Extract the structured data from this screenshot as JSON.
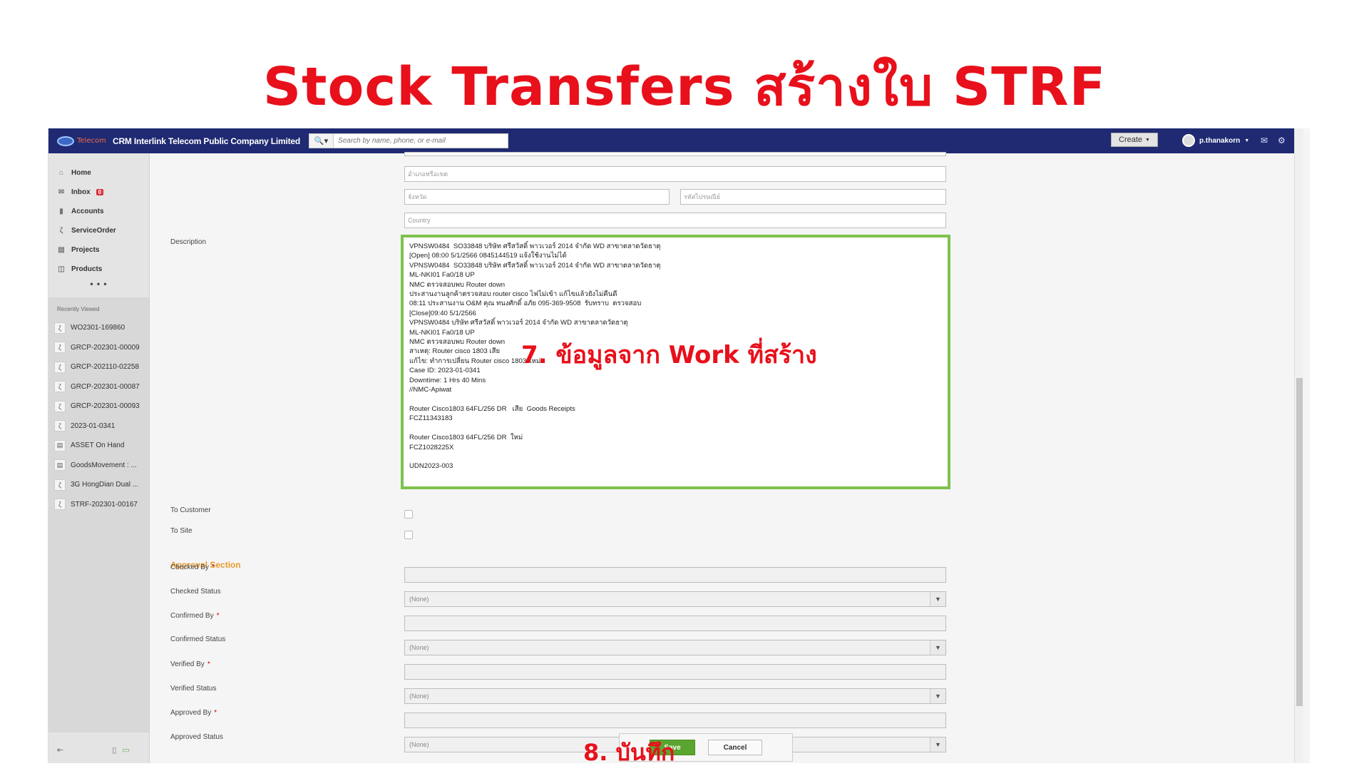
{
  "slide_title": "Stock Transfers สร้างใบ STRF",
  "header": {
    "logo_text": "Telecom",
    "company": "CRM Interlink Telecom Public Company Limited",
    "search_placeholder": "Search by name, phone, or e-mail",
    "create_label": "Create",
    "username": "p.thanakorn"
  },
  "sidebar": {
    "items": [
      {
        "label": "Home"
      },
      {
        "label": "Inbox",
        "badge": "0"
      },
      {
        "label": "Accounts"
      },
      {
        "label": "ServiceOrder"
      },
      {
        "label": "Projects"
      },
      {
        "label": "Products"
      }
    ],
    "more": "• • •",
    "recent_title": "Recently Viewed",
    "recent": [
      "WO2301-169860",
      "GRCP-202301-00009",
      "GRCP-202110-02258",
      "GRCP-202301-00087",
      "GRCP-202301-00093",
      "2023-01-0341",
      "ASSET On Hand",
      "GoodsMovement : ...",
      "3G HongDian Dual ...",
      "STRF-202301-00167"
    ]
  },
  "form": {
    "district_placeholder": "อำเภอหรือเขต",
    "province_placeholder": "จังหวัด",
    "postcode_placeholder": "รหัสไปรษณีย์",
    "country_placeholder": "Country",
    "description_label": "Description",
    "description_value": "VPNSW0484  SO33848 บริษัท ศรีสวัสดิ์ พาวเวอร์ 2014 จำกัด WD สาขาตลาดวัดธาตุ\n[Open] 08:00 5/1/2566 0845144519 แจ้งใช้งานไม่ได้\nVPNSW0484  SO33848 บริษัท ศรีสวัสดิ์ พาวเวอร์ 2014 จำกัด WD สาขาตลาดวัดธาตุ\nML-NKI01 Fa0/18 UP\nNMC ตรวจสอบพบ Router down\nประสานงานลูกค้าตรวจสอบ router cisco ไฟไม่เข้า แก้ไขแล้วยังไม่คืนดี\n08:11 ประสานงาน O&M คุณ ทนงศักดิ์ อภัย 095-369-9508  รับทราบ  ตรวจสอบ\n[Close]09:40 5/1/2566\nVPNSW0484 บริษัท ศรีสวัสดิ์ พาวเวอร์ 2014 จำกัด WD สาขาตลาดวัดธาตุ\nML-NKI01 Fa0/18 UP\nNMC ตรวจสอบพบ Router down\nสาเหตุ: Router cisco 1803 เสีย\nแก้ไข: ทำการเปลี่ยน Router cisco 1803 ใหม่\nCase ID: 2023-01-0341\nDowntime: 1 Hrs 40 Mins\n//NMC-Apiwat\n\nRouter Cisco1803 64FL/256 DR   เสีย  Goods Receipts\nFCZ11343183\n\nRouter Cisco1803 64FL/256 DR  ใหม่\nFCZ1028225X\n\nUDN2023-003",
    "to_customer_label": "To Customer",
    "to_site_label": "To Site",
    "approval_section": "Approval Section",
    "approval_rows": [
      {
        "label": "Checked By",
        "required": "*"
      },
      {
        "label": "Checked Status",
        "value": "(None)"
      },
      {
        "label": "Confirmed By",
        "required": "*"
      },
      {
        "label": "Confirmed Status",
        "value": "(None)"
      },
      {
        "label": "Verified By",
        "required": "*"
      },
      {
        "label": "Verified Status",
        "value": "(None)"
      },
      {
        "label": "Approved By",
        "required": "*"
      },
      {
        "label": "Approved Status",
        "value": "(None)"
      }
    ],
    "save_label": "Save",
    "cancel_label": "Cancel"
  },
  "annotations": {
    "step7": "7. ข้อมูลจาก Work ที่สร้าง",
    "step8": "8. บันทึก"
  },
  "colors": {
    "header_bg": "#1f2a72",
    "title_red": "#e8101b",
    "highlight_green": "#7ec24e",
    "section_orange": "#e89a2c",
    "save_green": "#59a52f"
  }
}
